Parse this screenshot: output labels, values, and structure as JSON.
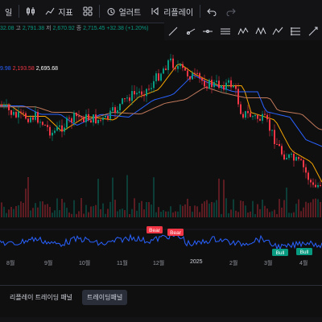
{
  "toolbar": {
    "indicators_label": "지표",
    "alerts_label": "얼러트",
    "replay_label": "리플레이",
    "partial_left_label": "일"
  },
  "ohlc": {
    "open": "32.08",
    "high_label": "고",
    "high": "2,791.38",
    "low_label": "저",
    "low": "2,670.92",
    "close_label": "종",
    "close": "2,715.45",
    "change": "+32.38 (+1.20%)"
  },
  "ma_values": [
    {
      "value": "9.98",
      "color": "#2962ff"
    },
    {
      "value": "2,193.58",
      "color": "#f23645"
    },
    {
      "value": "2,695.68",
      "color": "#ffffff"
    }
  ],
  "signals": [
    {
      "label": "Bear",
      "color": "#f23645"
    },
    {
      "label": "Bear",
      "color": "#f23645"
    },
    {
      "label": "Bull",
      "color": "#089981"
    },
    {
      "label": "Bull",
      "color": "#089981"
    }
  ],
  "date_axis": [
    "8월",
    "9월",
    "10월",
    "11월",
    "12월",
    "2025",
    "2월",
    "3월",
    "4월"
  ],
  "bottom_tabs": [
    {
      "label": "리플레이 트레이딩 패널",
      "active": false
    },
    {
      "label": "트레이딩패널",
      "active": true
    }
  ],
  "colors": {
    "up": "#089981",
    "down": "#f23645",
    "osc": "#2962ff"
  }
}
